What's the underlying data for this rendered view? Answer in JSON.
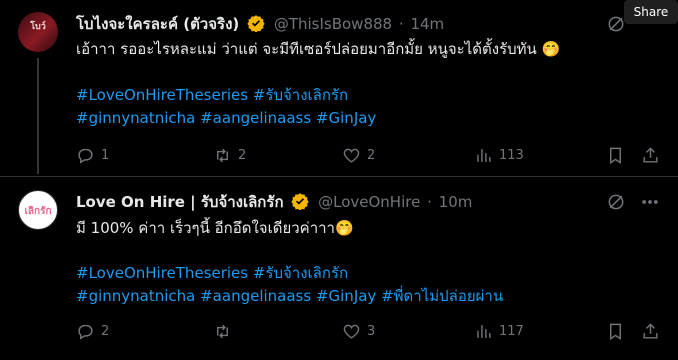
{
  "tweets": [
    {
      "avatar_text": "โบว์",
      "name": "โบไงจะใครละค์ (ตัวจริง)",
      "handle": "@ThisIsBow888",
      "time": "14m",
      "text": "เอ้าาา รออะไรหละแม่ ว่าแต่ จะมีทีเซอร์ปล่อยมาอีกมั้ย หนูจะได้ตั้งรับทัน 🤭",
      "hashtags_line1": "#LoveOnHireTheseries #รับจ้างเลิกรัก",
      "hashtags_line2": "#ginnynatnicha #aangelinaass #GinJay",
      "replies": "1",
      "reposts": "2",
      "likes": "2",
      "views": "113"
    },
    {
      "avatar_text": "เลิกรัก",
      "name": "Love On Hire | รับจ้างเลิกรัก",
      "handle": "@LoveOnHire",
      "time": "10m",
      "text": "มี 100% ค่าา เร็วๆนี้ อีกอึดใจเดียวค่าาา🤭",
      "hashtags_line1": "#LoveOnHireTheseries #รับจ้างเลิกรัก",
      "hashtags_line2": "#ginnynatnicha #aangelinaass #GinJay #พี่ดาไม่ปล่อยผ่าน",
      "replies": "2",
      "reposts": "",
      "likes": "3",
      "views": "117"
    }
  ],
  "share_label": "Share",
  "dot": "·",
  "colors": {
    "accent": "#1d9bf0",
    "verified": "#f4b400",
    "text": "#e7e9ea",
    "muted": "#71767b"
  }
}
